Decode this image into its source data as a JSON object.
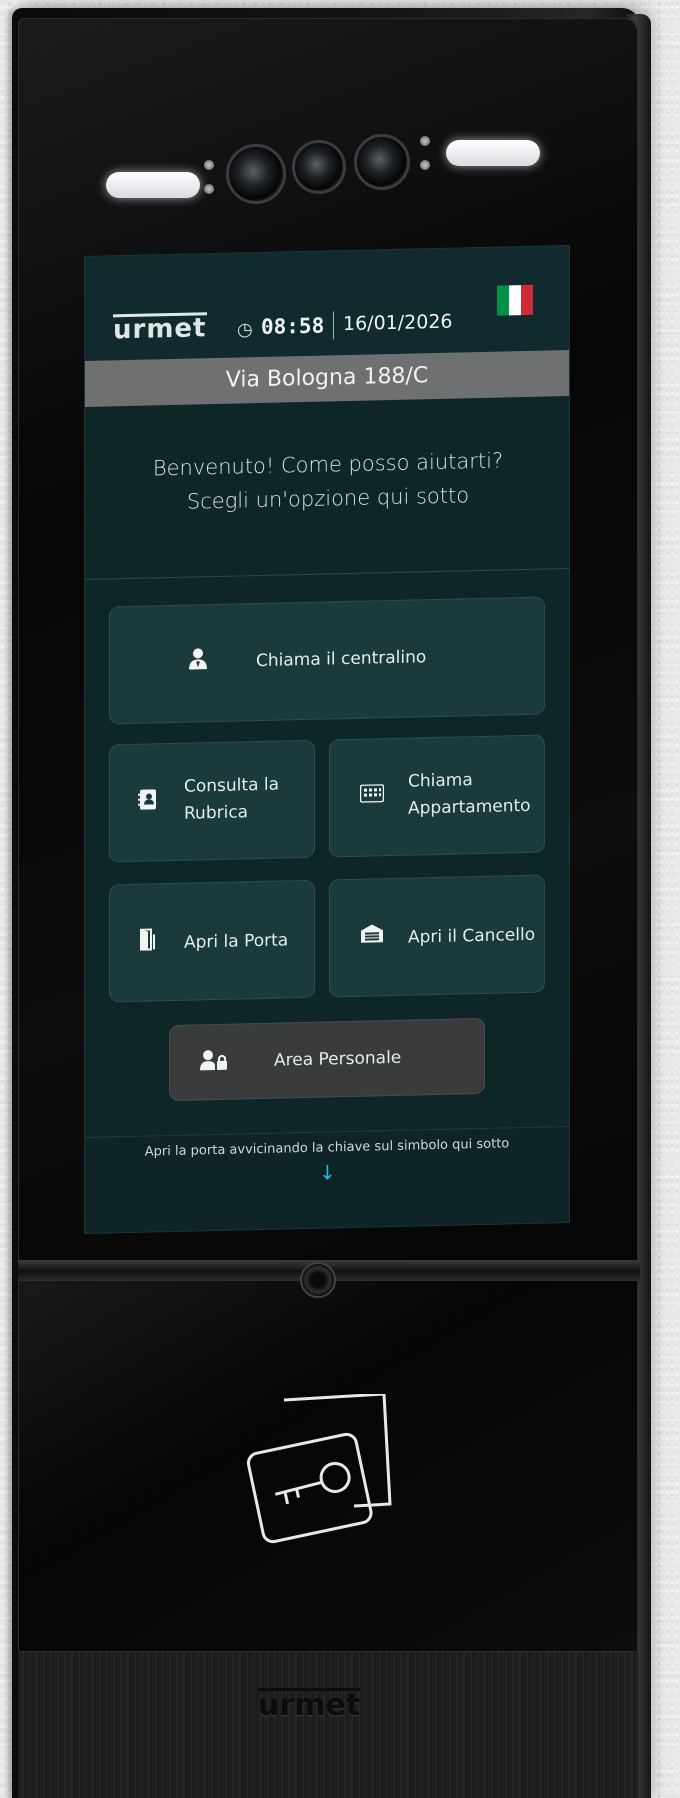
{
  "device": {
    "brand": "urmet",
    "bottom_brand": "urmet"
  },
  "header": {
    "logo": "urmet",
    "time": "08:58",
    "date": "16/01/2026",
    "flag_colors": [
      "#009246",
      "#ffffff",
      "#ce2b37"
    ]
  },
  "address": "Via Bologna 188/C",
  "welcome_message": "Benvenuto! Come posso aiutarti? Scegli un'opzione qui sotto",
  "buttons": {
    "centralino": "Chiama il centralino",
    "rubrica": "Consulta la Rubrica",
    "appartamento": "Chiama Appartamento",
    "porta": "Apri la Porta",
    "cancello": "Apri il Cancello",
    "personale": "Area Personale"
  },
  "footer": {
    "hint": "Apri la porta avvicinando la chiave sul simbolo qui sotto",
    "arrow": "↓"
  },
  "colors": {
    "screen_bg": "#0f2629",
    "button_bg": "#1a3a3c",
    "address_bar": "#6f7072",
    "accent_arrow": "#2bb7d8"
  }
}
